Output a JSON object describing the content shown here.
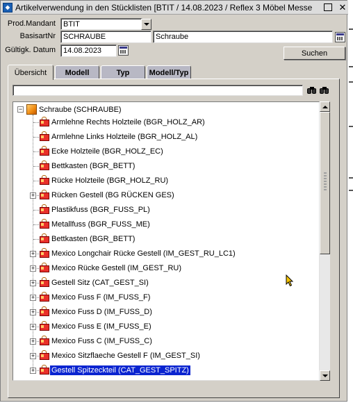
{
  "window": {
    "title": "Artikelverwendung in den Stücklisten   [BTIT / 14.08.2023 / Reflex 3 Möbel Messe",
    "icon": "app-icon",
    "close_label": "✕"
  },
  "form": {
    "mandant_label": "Prod.Mandant",
    "mandant_value": "BTIT",
    "basisartnr_label": "BasisartNr",
    "basisartnr_value": "SCHRAUBE",
    "basisartnr_desc": "Schraube",
    "datum_label": "Gültigk. Datum",
    "datum_value": "14.08.2023",
    "search_button": "Suchen"
  },
  "tabs": [
    {
      "label": "Übersicht",
      "active": true
    },
    {
      "label": "Modell",
      "active": false
    },
    {
      "label": "Typ",
      "active": false
    },
    {
      "label": "Modell/Typ",
      "active": false
    }
  ],
  "filter": {
    "value": "",
    "icons": [
      "binoculars-icon",
      "binoculars-next-icon"
    ]
  },
  "tree": {
    "root": {
      "label": "Schraube (SCHRAUBE)",
      "expanded": true,
      "icon": "assembly-icon"
    },
    "items": [
      {
        "label": "Armlehne Rechts Holzteile (BGR_HOLZ_AR)",
        "expandable": false,
        "selected": false
      },
      {
        "label": "Armlehne Links Holzteile (BGR_HOLZ_AL)",
        "expandable": false,
        "selected": false
      },
      {
        "label": "Ecke Holzteile (BGR_HOLZ_EC)",
        "expandable": false,
        "selected": false
      },
      {
        "label": "Bettkasten (BGR_BETT)",
        "expandable": false,
        "selected": false
      },
      {
        "label": "Rücke Holzteile (BGR_HOLZ_RU)",
        "expandable": false,
        "selected": false
      },
      {
        "label": "Rücken Gestell (BG RÜCKEN GES)",
        "expandable": true,
        "selected": false
      },
      {
        "label": "Plastikfuss (BGR_FUSS_PL)",
        "expandable": false,
        "selected": false
      },
      {
        "label": "Metallfuss (BGR_FUSS_ME)",
        "expandable": false,
        "selected": false
      },
      {
        "label": "Bettkasten (BGR_BETT)",
        "expandable": false,
        "selected": false
      },
      {
        "label": "Mexico Longchair Rücke Gestell (IM_GEST_RU_LC1)",
        "expandable": true,
        "selected": false
      },
      {
        "label": "Mexico Rücke Gestell (IM_GEST_RU)",
        "expandable": true,
        "selected": false
      },
      {
        "label": "Gestell Sitz (CAT_GEST_SI)",
        "expandable": true,
        "selected": false
      },
      {
        "label": "Mexico Fuss F (IM_FUSS_F)",
        "expandable": true,
        "selected": false
      },
      {
        "label": "Mexico Fuss D (IM_FUSS_D)",
        "expandable": true,
        "selected": false
      },
      {
        "label": "Mexico Fuss E (IM_FUSS_E)",
        "expandable": true,
        "selected": false
      },
      {
        "label": "Mexico Fuss C (IM_FUSS_C)",
        "expandable": true,
        "selected": false
      },
      {
        "label": "Mexico Sitzflaeche Gestell F (IM_GEST_SI)",
        "expandable": true,
        "selected": false
      },
      {
        "label": "Gestell Spitzeckteil (CAT_GEST_SPITZ)",
        "expandable": true,
        "selected": true
      }
    ]
  },
  "colors": {
    "selection": "#0a24d0",
    "dialog_bg": "#d4d0c8",
    "part_icon": "#e9302a",
    "root_icon": "#f08a10"
  }
}
